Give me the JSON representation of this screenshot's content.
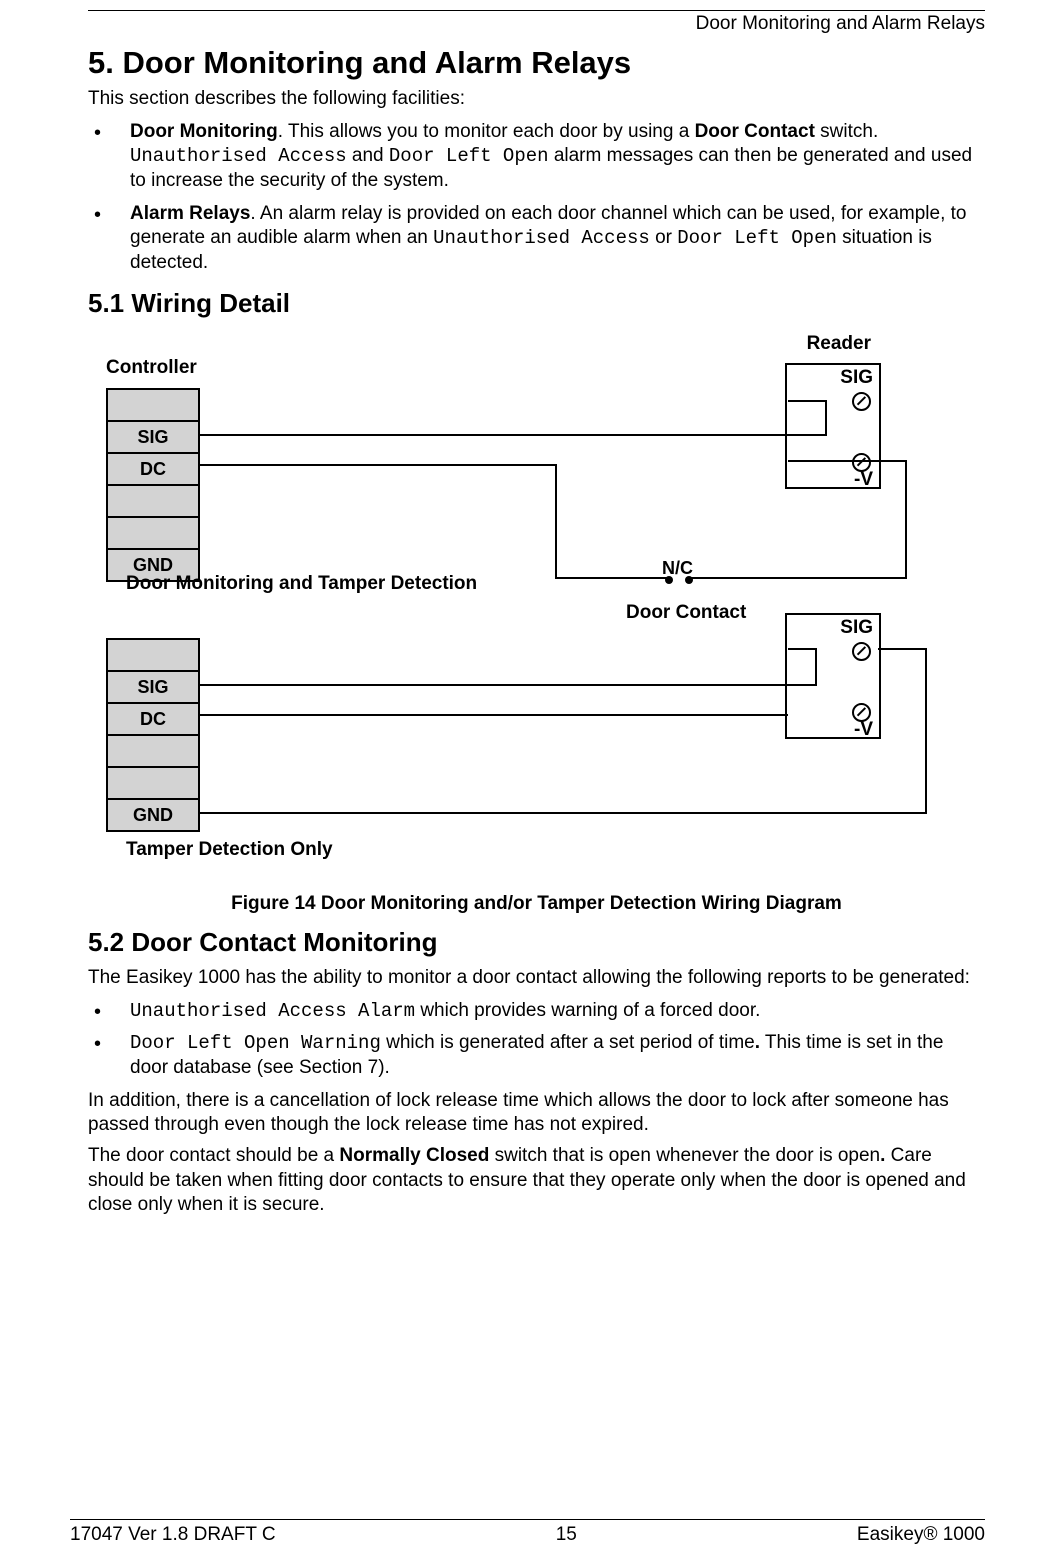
{
  "header": {
    "running": "Door Monitoring and Alarm Relays"
  },
  "section": {
    "title": "5. Door Monitoring and Alarm Relays",
    "intro": "This section describes the following facilities:",
    "bullets": [
      {
        "lead": "Door Monitoring",
        "tail1": ".  This allows you to monitor each door by using a ",
        "bold1": "Door Contact",
        "tail2": " switch. ",
        "mono1": "Unauthorised Access",
        "mid1": " and ",
        "mono2": "Door Left Open",
        "tail3": " alarm messages can then be generated and used to increase the security of the system."
      },
      {
        "lead": "Alarm Relays",
        "tail1": ".  An alarm relay is provided on each door channel which can be used, for example, to generate an audible alarm when an ",
        "mono1": "Unauthorised Access",
        "mid1": " or ",
        "mono2": "Door Left Open",
        "tail3": " situation is detected."
      }
    ]
  },
  "wiring": {
    "title": "5.1 Wiring Detail",
    "labels": {
      "controller": "Controller",
      "reader": "Reader",
      "sig": "SIG",
      "dc": "DC",
      "gnd": "GND",
      "negv": "-V",
      "nc": "N/C",
      "doorContact": "Door Contact",
      "subt1": "Door Monitoring and Tamper Detection",
      "subt2": "Tamper Detection Only"
    },
    "caption": "Figure 14 Door Monitoring and/or Tamper Detection Wiring Diagram"
  },
  "dcm": {
    "title": "5.2 Door Contact Monitoring",
    "p1": "The Easikey 1000 has the ability to monitor a door contact allowing the following reports to be generated:",
    "bullets": [
      {
        "mono": "Unauthorised Access Alarm",
        "rest": " which provides warning of a forced door."
      },
      {
        "mono": "Door Left Open Warning",
        "rest": " which is generated after a set period of time",
        "bolddot": ".",
        "rest2": "  This time is set in the door database (see Section 7)."
      }
    ],
    "p2": "In addition, there is a cancellation of lock release time which allows the door to lock after someone has passed through even though the lock release time has not expired.",
    "p3a": "The door contact should be a ",
    "p3bold": "Normally Closed",
    "p3b": " switch that is open whenever the door is open",
    "p3dot": ".",
    "p3c": "  Care should be taken when fitting door contacts to ensure that they operate only when the door is opened and close only when it is secure."
  },
  "footer": {
    "left": "17047 Ver 1.8 DRAFT C",
    "center": "15",
    "right": "Easikey® 1000"
  }
}
